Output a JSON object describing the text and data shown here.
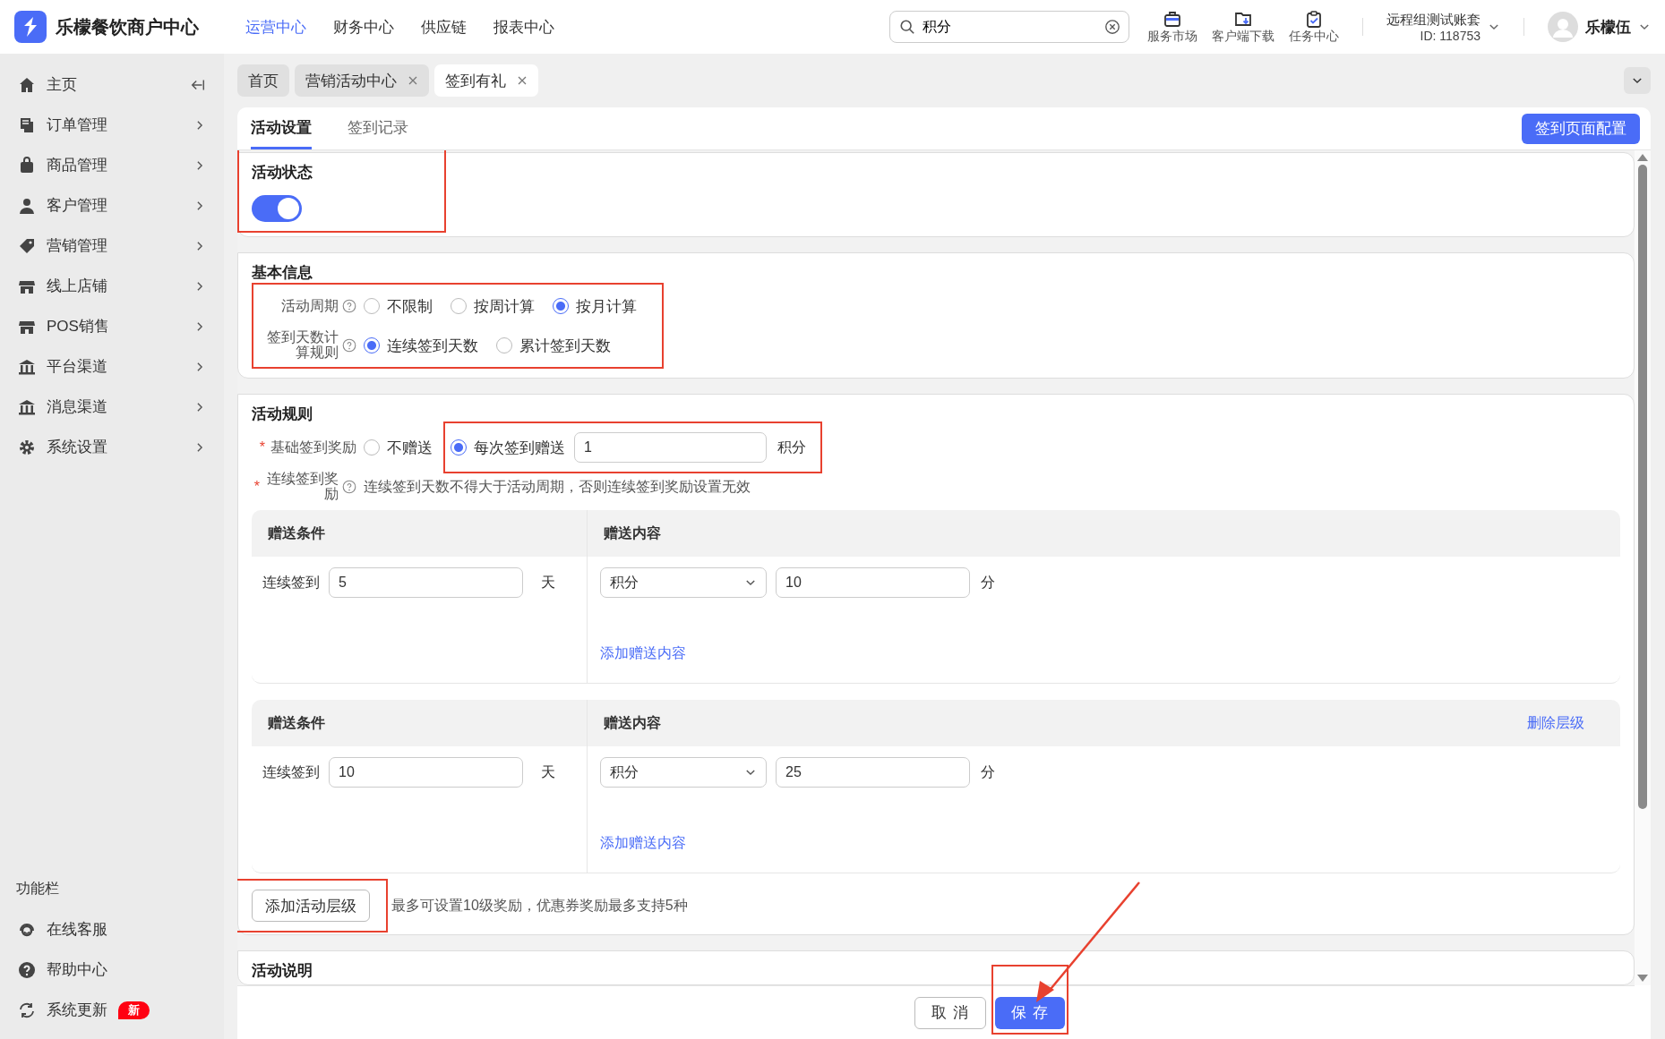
{
  "app": {
    "title": "乐檬餐饮商户中心"
  },
  "top_nav": [
    {
      "label": "运营中心",
      "selected": true
    },
    {
      "label": "财务中心",
      "selected": false
    },
    {
      "label": "供应链",
      "selected": false
    },
    {
      "label": "报表中心",
      "selected": false
    }
  ],
  "search": {
    "value": "积分"
  },
  "toolbar": [
    {
      "label": "服务市场"
    },
    {
      "label": "客户端下载"
    },
    {
      "label": "任务中心"
    }
  ],
  "account": {
    "name": "远程组测试账套",
    "id": "ID: 118753"
  },
  "user": {
    "name": "乐檬伍"
  },
  "sidebar": {
    "items": [
      {
        "label": "主页",
        "submenu": false
      },
      {
        "label": "订单管理",
        "submenu": true
      },
      {
        "label": "商品管理",
        "submenu": true
      },
      {
        "label": "客户管理",
        "submenu": true
      },
      {
        "label": "营销管理",
        "submenu": true
      },
      {
        "label": "线上店铺",
        "submenu": true
      },
      {
        "label": "POS销售",
        "submenu": true
      },
      {
        "label": "平台渠道",
        "submenu": true
      },
      {
        "label": "消息渠道",
        "submenu": true
      },
      {
        "label": "系统设置",
        "submenu": true
      }
    ],
    "section_title": "功能栏",
    "tools": [
      {
        "label": "在线客服"
      },
      {
        "label": "帮助中心"
      },
      {
        "label": "系统更新",
        "badge": "新"
      }
    ]
  },
  "page_tabs": [
    {
      "label": "首页",
      "selected": false,
      "closable": false
    },
    {
      "label": "营销活动中心",
      "selected": false,
      "closable": true
    },
    {
      "label": "签到有礼",
      "selected": true,
      "closable": true
    }
  ],
  "sub_tabs": [
    {
      "label": "活动设置",
      "selected": true
    },
    {
      "label": "签到记录",
      "selected": false
    }
  ],
  "config_button": "签到页面配置",
  "status_card": {
    "title": "活动状态",
    "on": true,
    "highlighted": true
  },
  "basic_info": {
    "title": "基本信息",
    "highlighted": true,
    "fields": [
      {
        "label": "活动周期",
        "options": [
          {
            "label": "不限制",
            "selected": false
          },
          {
            "label": "按周计算",
            "selected": false
          },
          {
            "label": "按月计算",
            "selected": true
          }
        ]
      },
      {
        "label": "签到天数计算规则",
        "options": [
          {
            "label": "连续签到天数",
            "selected": true
          },
          {
            "label": "累计签到天数",
            "selected": false
          }
        ]
      }
    ]
  },
  "rules": {
    "title": "活动规则",
    "base_reward": {
      "label": "基础签到奖励",
      "required_mark": "*",
      "options": [
        {
          "label": "不赠送",
          "selected": false
        },
        {
          "label": "每次签到赠送",
          "selected": true
        }
      ],
      "value": "1",
      "unit": "积分",
      "highlighted": true
    },
    "streak": {
      "label": "连续签到奖励",
      "required_mark": "*",
      "note": "连续签到天数不得大于活动周期，否则连续签到奖励设置无效"
    },
    "tiers": [
      {
        "condition_header": "赠送条件",
        "content_header": "赠送内容",
        "condition_label": "连续签到",
        "days": "5",
        "days_unit": "天",
        "rewards": [
          {
            "type": "积分",
            "value": "10",
            "unit": "分"
          }
        ],
        "add_link": "添加赠送内容"
      },
      {
        "condition_header": "赠送条件",
        "content_header": "赠送内容",
        "delete_link": "删除层级",
        "condition_label": "连续签到",
        "days": "10",
        "days_unit": "天",
        "rewards": [
          {
            "type": "积分",
            "value": "25",
            "unit": "分"
          }
        ],
        "add_link": "添加赠送内容"
      }
    ],
    "add_level_button": "添加活动层级",
    "add_level_highlighted": true,
    "limit_note": "最多可设置10级奖励，优惠券奖励最多支持5种"
  },
  "description_card": {
    "title": "活动说明"
  },
  "footer": {
    "buttons": [
      {
        "label": "取 消",
        "kind": "default"
      },
      {
        "label": "保 存",
        "kind": "primary",
        "highlighted": true,
        "arrow": true
      }
    ]
  }
}
